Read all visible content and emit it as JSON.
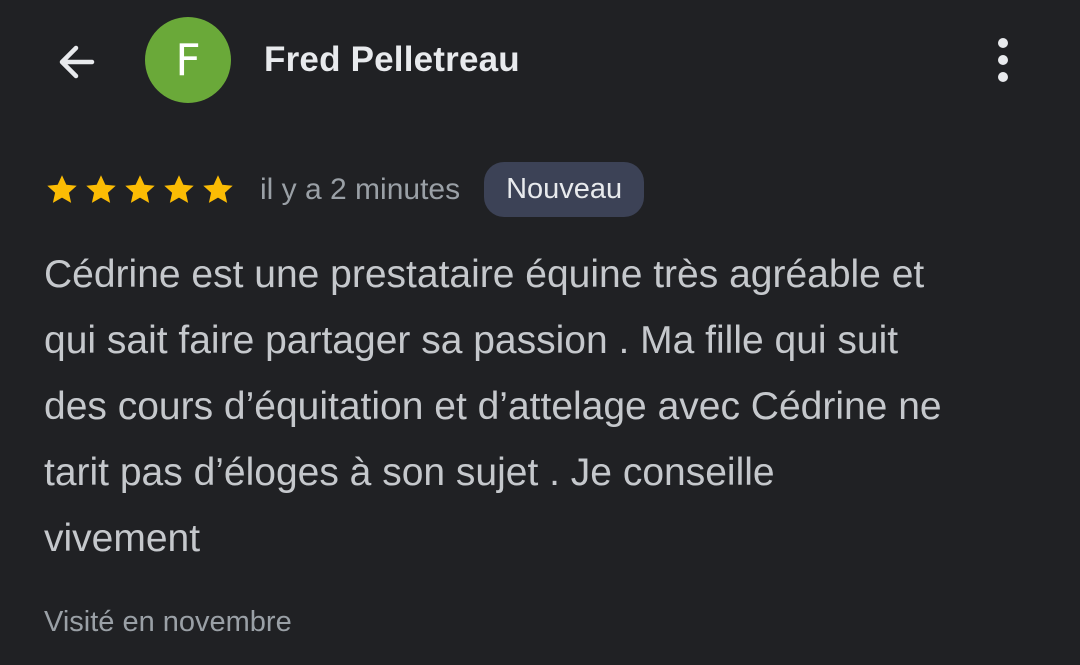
{
  "header": {
    "back_icon": "arrow-left-icon",
    "avatar_letter": "F",
    "avatar_color": "#6aa939",
    "author_name": "Fred Pelletreau",
    "menu_icon": "more-vertical-icon"
  },
  "review": {
    "rating": 5,
    "rating_max": 5,
    "star_color": "#fbbc04",
    "time_ago": "il y a 2 minutes",
    "badge_label": "Nouveau",
    "badge_color": "#3c4256",
    "text_lines": [
      "Cédrine est une prestataire équine très agréable et",
      "qui sait faire partager sa passion . Ma fille qui suit",
      "des cours d’équitation et d’attelage avec Cédrine ne",
      "tarit pas d’éloges à son sujet . Je conseille",
      "vivement"
    ],
    "visited": "Visité en novembre"
  }
}
